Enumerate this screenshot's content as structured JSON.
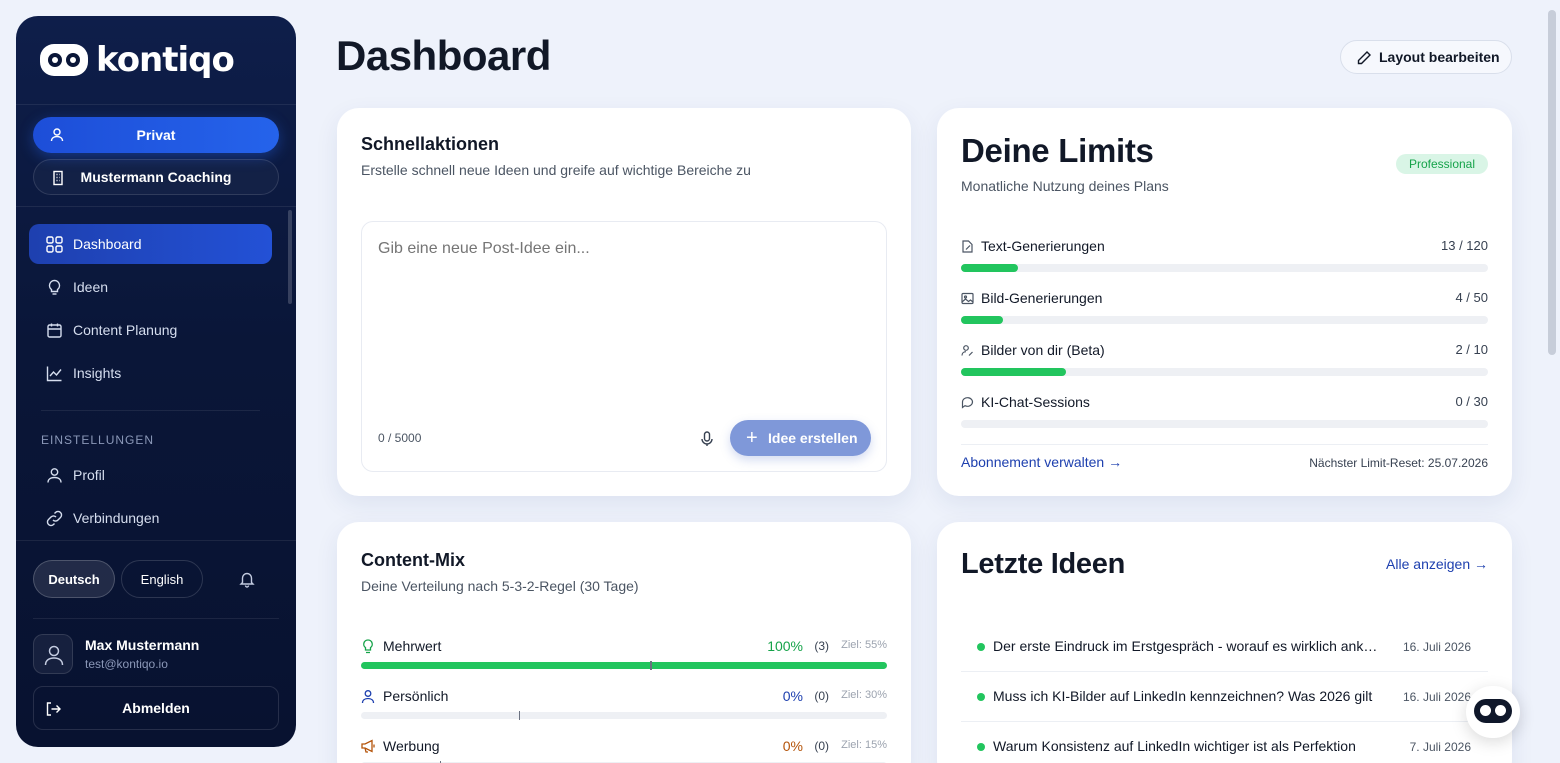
{
  "brand": {
    "name": "kontiqo"
  },
  "workspaces": [
    {
      "label": "Privat",
      "icon": "user-icon",
      "active": true
    },
    {
      "label": "Mustermann Coaching",
      "icon": "building-icon",
      "active": false
    }
  ],
  "nav": {
    "items": [
      {
        "label": "Dashboard",
        "icon": "grid-icon",
        "active": true
      },
      {
        "label": "Ideen",
        "icon": "lightbulb-icon"
      },
      {
        "label": "Content Planung",
        "icon": "calendar-icon"
      },
      {
        "label": "Insights",
        "icon": "chart-line-icon"
      }
    ],
    "settings_label": "EINSTELLUNGEN",
    "settings_items": [
      {
        "label": "Profil",
        "icon": "user-icon"
      },
      {
        "label": "Verbindungen",
        "icon": "link-icon"
      }
    ]
  },
  "language": {
    "de": "Deutsch",
    "en": "English",
    "selected": "Deutsch"
  },
  "user": {
    "name": "Max Mustermann",
    "email": "test@kontiqo.io",
    "logout_label": "Abmelden"
  },
  "header": {
    "title": "Dashboard",
    "layout_button": "Layout bearbeiten"
  },
  "quick_actions": {
    "title": "Schnellaktionen",
    "subtitle": "Erstelle schnell neue Ideen und greife auf wichtige Bereiche zu",
    "placeholder": "Gib eine neue Post-Idee ein...",
    "char_count": "0 / 5000",
    "create_button": "Idee erstellen"
  },
  "limits": {
    "title": "Deine Limits",
    "subtitle": "Monatliche Nutzung deines Plans",
    "plan_badge": "Professional",
    "items": [
      {
        "label": "Text-Generierungen",
        "value": "13 / 120",
        "used": 13,
        "max": 120,
        "icon": "pen-doc-icon"
      },
      {
        "label": "Bild-Generierungen",
        "value": "4 / 50",
        "used": 4,
        "max": 50,
        "icon": "image-icon"
      },
      {
        "label": "Bilder von dir (Beta)",
        "value": "2 / 10",
        "used": 2,
        "max": 10,
        "icon": "user-pen-icon"
      },
      {
        "label": "KI-Chat-Sessions",
        "value": "0 / 30",
        "used": 0,
        "max": 30,
        "icon": "chat-icon"
      }
    ],
    "manage_link": "Abonnement verwalten →",
    "reset_text": "Nächster Limit-Reset: 25.07.2026"
  },
  "content_mix": {
    "title": "Content-Mix",
    "subtitle": "Deine Verteilung nach 5-3-2-Regel (30 Tage)",
    "rows": [
      {
        "label": "Mehrwert",
        "pct": "100%",
        "count": "(3)",
        "goal": "Ziel: 55%",
        "value": 1.0,
        "target": 0.55,
        "color": "#16a34a",
        "icon": "lightbulb-icon"
      },
      {
        "label": "Persönlich",
        "pct": "0%",
        "count": "(0)",
        "goal": "Ziel: 30%",
        "value": 0,
        "target": 0.3,
        "color": "#1e40af",
        "icon": "user-icon"
      },
      {
        "label": "Werbung",
        "pct": "0%",
        "count": "(0)",
        "goal": "Ziel: 15%",
        "value": 0,
        "target": 0.15,
        "color": "#b45309",
        "icon": "megaphone-icon"
      }
    ]
  },
  "recent_ideas": {
    "title": "Letzte Ideen",
    "show_all": "Alle anzeigen →",
    "items": [
      {
        "text": "Der erste Eindruck im Erstgespräch - worauf es wirklich ankommt",
        "date": "16. Juli 2026"
      },
      {
        "text": "Muss ich KI-Bilder auf LinkedIn kennzeichnen? Was 2026 gilt",
        "date": "16. Juli 2026"
      },
      {
        "text": "Warum Konsistenz auf LinkedIn wichtiger ist als Perfektion",
        "date": "7. Juli 2026"
      }
    ]
  },
  "colors": {
    "accent": "#2563eb",
    "sidebar": "#0a1638",
    "success": "#22c55e"
  }
}
